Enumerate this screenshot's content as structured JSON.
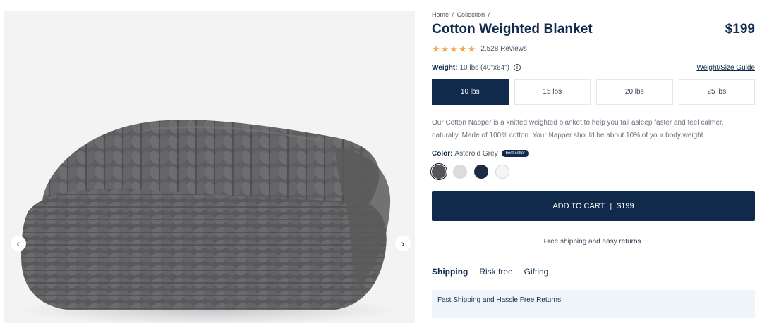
{
  "gallery": {
    "prev_icon": "chevron-left-icon",
    "next_icon": "chevron-right-icon",
    "prev_glyph": "‹",
    "next_glyph": "›"
  },
  "product": {
    "breadcrumb": [
      "Home",
      "/",
      "Collection",
      "/"
    ],
    "title": "Cotton Weighted Blanket",
    "price": "$199",
    "rating": 5,
    "reviews": "2,528 Reviews",
    "weight_label": "Weight:",
    "weight_value": "10 lbs (40\"x64\")",
    "info_glyph": "i",
    "size_guide": "Weight/Size Guide",
    "weights": [
      "10 lbs",
      "15 lbs",
      "20 lbs",
      "25 lbs"
    ],
    "selected_weight": "10 lbs",
    "description": "Our Cotton Napper is a knitted weighted blanket to help you fall asleep faster and feel calmer, naturally. Made of 100% cotton. Your Napper should be about 10% of your body weight.",
    "color_label": "Color:",
    "color_value": "Asteroid Grey",
    "badge": "best seller",
    "swatches": [
      {
        "color": "#555659",
        "selected": true
      },
      {
        "color": "#dcdcdc",
        "selected": false
      },
      {
        "color": "#1d2a44",
        "selected": false
      },
      {
        "color": "#f6f5f1",
        "selected": false
      }
    ],
    "cta": {
      "label": "ADD TO CART",
      "separator": "|",
      "price": "$199"
    },
    "shipping_note": "Free shipping and easy returns.",
    "tabs": [
      {
        "label": "Shipping",
        "active": true
      },
      {
        "label": "Risk free",
        "active": false
      },
      {
        "label": "Gifting",
        "active": false
      }
    ],
    "accordion_title": "Fast Shipping and Hassle Free Returns"
  },
  "colors": {
    "navy": "#0f2a4a",
    "star": "#f0a94e",
    "accordion_bg": "#eef4f9",
    "gallery_bg": "#f3f3f4"
  }
}
